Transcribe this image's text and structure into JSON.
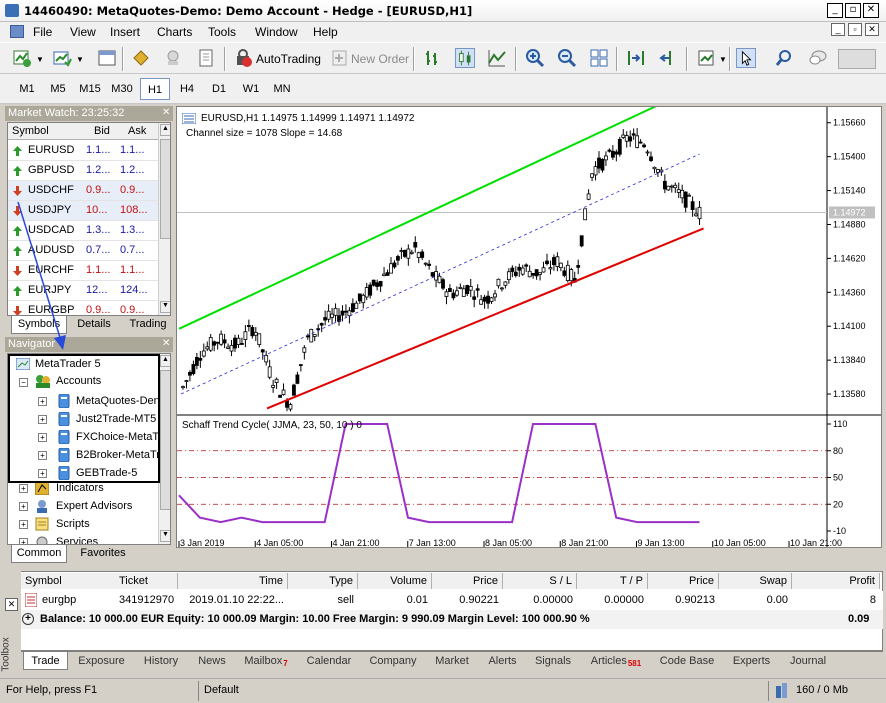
{
  "window": {
    "title": "14460490: MetaQuotes-Demo: Demo Account - Hedge - [EURUSD,H1]"
  },
  "menu": [
    "File",
    "View",
    "Insert",
    "Charts",
    "Tools",
    "Window",
    "Help"
  ],
  "toolbar": {
    "autotrading": "AutoTrading",
    "new_order": "New Order"
  },
  "timeframes": [
    "M1",
    "M5",
    "M15",
    "M30",
    "H1",
    "H4",
    "D1",
    "W1",
    "MN"
  ],
  "active_timeframe": "H1",
  "market_watch": {
    "title": "Market Watch: 23:25:32",
    "columns": [
      "Symbol",
      "Bid",
      "Ask"
    ],
    "rows": [
      {
        "symbol": "EURUSD",
        "bid": "1.1...",
        "ask": "1.1...",
        "dir": "up"
      },
      {
        "symbol": "GBPUSD",
        "bid": "1.2...",
        "ask": "1.2...",
        "dir": "up"
      },
      {
        "symbol": "USDCHF",
        "bid": "0.9...",
        "ask": "0.9...",
        "dir": "down"
      },
      {
        "symbol": "USDJPY",
        "bid": "10...",
        "ask": "108...",
        "dir": "down"
      },
      {
        "symbol": "USDCAD",
        "bid": "1.3...",
        "ask": "1.3...",
        "dir": "up"
      },
      {
        "symbol": "AUDUSD",
        "bid": "0.7...",
        "ask": "0.7...",
        "dir": "up"
      },
      {
        "symbol": "EURCHF",
        "bid": "1.1...",
        "ask": "1.1...",
        "dir": "down"
      },
      {
        "symbol": "EURJPY",
        "bid": "12...",
        "ask": "124...",
        "dir": "up"
      },
      {
        "symbol": "EURGBP",
        "bid": "0.9...",
        "ask": "0.9...",
        "dir": "down"
      }
    ],
    "tabs": [
      "Symbols",
      "Details",
      "Trading"
    ]
  },
  "navigator": {
    "title": "Navigator",
    "root": "MetaTrader 5",
    "accounts_label": "Accounts",
    "accounts": [
      "MetaQuotes-Den",
      "Just2Trade-MT5",
      "FXChoice-MetaT",
      "B2Broker-MetaTr",
      "GEBTrade-5"
    ],
    "items": [
      "Indicators",
      "Expert Advisors",
      "Scripts",
      "Services"
    ],
    "tabs": [
      "Common",
      "Favorites"
    ]
  },
  "chart": {
    "header": "EURUSD,H1  1.14975 1.14999 1.14971 1.14972",
    "channel_info": "Channel size = 1078 Slope = 14.68",
    "price_labels": [
      "1.15660",
      "1.15400",
      "1.15140",
      "1.14880",
      "1.14620",
      "1.14360",
      "1.14100",
      "1.13840",
      "1.13580"
    ],
    "current_price": "1.14972",
    "indicator_title": "Schaff Trend Cycle( JJMA, 23, 50, 10 ) 0",
    "indicator_levels": [
      "110",
      "80",
      "50",
      "20",
      "-10"
    ],
    "time_labels": [
      "3 Jan 2019",
      "4 Jan 05:00",
      "4 Jan 21:00",
      "7 Jan 13:00",
      "8 Jan 05:00",
      "8 Jan 21:00",
      "9 Jan 13:00",
      "10 Jan 05:00",
      "10 Jan 21:00"
    ]
  },
  "chart_data": {
    "type": "line",
    "series": [
      {
        "name": "EURUSD,H1",
        "values": [
          1.1363,
          1.139,
          1.14,
          1.1395,
          1.141,
          1.137,
          1.135,
          1.14,
          1.1415,
          1.142,
          1.143,
          1.1445,
          1.146,
          1.147,
          1.145,
          1.1435,
          1.144,
          1.143,
          1.1445,
          1.1455,
          1.145,
          1.146,
          1.1445,
          1.153,
          1.154,
          1.1555,
          1.155,
          1.152,
          1.151,
          1.1497
        ]
      },
      {
        "name": "Schaff Trend Cycle( JJMA, 23, 50, 10 ) 0",
        "values": [
          30,
          5,
          0,
          5,
          0,
          0,
          0,
          0,
          110,
          110,
          110,
          5,
          0,
          0,
          0,
          0,
          0,
          110,
          110,
          110,
          110,
          5,
          0,
          0,
          0,
          0
        ]
      }
    ],
    "ylim": [
      1.1345,
      1.1575
    ]
  },
  "trade": {
    "columns": [
      "Symbol",
      "Ticket",
      "Time",
      "Type",
      "Volume",
      "Price",
      "S / L",
      "T / P",
      "Price",
      "Swap",
      "Profit"
    ],
    "row": {
      "symbol": "eurgbp",
      "ticket": "341912970",
      "time": "2019.01.10 22:22...",
      "type": "sell",
      "volume": "0.01",
      "price": "0.90221",
      "sl": "0.00000",
      "tp": "0.00000",
      "price2": "0.90213",
      "swap": "0.00",
      "profit": "8"
    },
    "balance": "Balance: 10 000.00 EUR  Equity: 10 000.09  Margin: 10.00  Free Margin: 9 990.09  Margin Level: 100 000.90 %",
    "balance_profit": "0.09"
  },
  "toolbox": {
    "label": "Toolbox",
    "tabs": [
      {
        "label": "Trade",
        "badge": ""
      },
      {
        "label": "Exposure",
        "badge": ""
      },
      {
        "label": "History",
        "badge": ""
      },
      {
        "label": "News",
        "badge": ""
      },
      {
        "label": "Mailbox",
        "badge": "7"
      },
      {
        "label": "Calendar",
        "badge": ""
      },
      {
        "label": "Company",
        "badge": ""
      },
      {
        "label": "Market",
        "badge": ""
      },
      {
        "label": "Alerts",
        "badge": ""
      },
      {
        "label": "Signals",
        "badge": ""
      },
      {
        "label": "Articles",
        "badge": "581"
      },
      {
        "label": "Code Base",
        "badge": ""
      },
      {
        "label": "Experts",
        "badge": ""
      },
      {
        "label": "Journal",
        "badge": ""
      }
    ]
  },
  "status": {
    "help": "For Help, press F1",
    "profile": "Default",
    "traffic": "160 / 0 Mb"
  }
}
